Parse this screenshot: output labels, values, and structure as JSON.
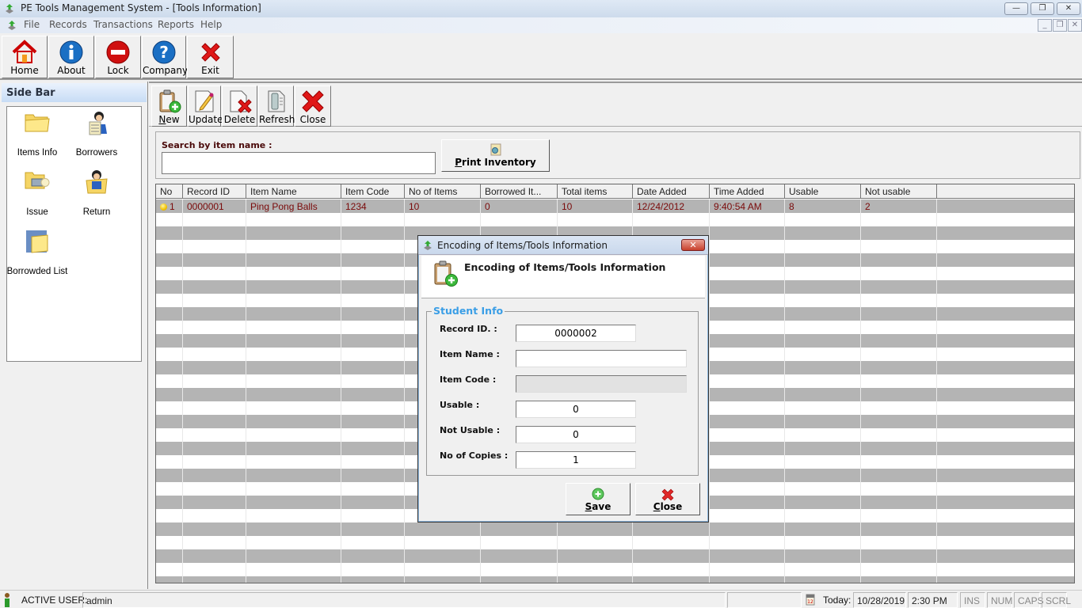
{
  "window": {
    "title": "PE Tools Management System - [Tools Information]",
    "controls": {
      "minimize": "—",
      "restore": "❐",
      "close": "✕"
    }
  },
  "menu": {
    "items": [
      "File",
      "Records",
      "Transactions",
      "Reports",
      "Help"
    ],
    "mdi_controls": {
      "minimize": "_",
      "restore": "❐",
      "close": "✕"
    }
  },
  "main_toolbar": {
    "buttons": [
      {
        "label": "Home",
        "icon": "home-icon"
      },
      {
        "label": "About",
        "icon": "info-icon"
      },
      {
        "label": "Lock",
        "icon": "lock-icon"
      },
      {
        "label": "Company",
        "icon": "help-icon"
      },
      {
        "label": "Exit",
        "icon": "exit-icon"
      }
    ]
  },
  "sidebar": {
    "title": "Side Bar",
    "items": [
      {
        "label": "Items Info",
        "icon": "folder-icon"
      },
      {
        "label": "Borrowers",
        "icon": "borrowers-icon"
      },
      {
        "label": "Issue",
        "icon": "issue-icon"
      },
      {
        "label": "Return",
        "icon": "return-icon"
      },
      {
        "label": "Borrowded List",
        "icon": "borrowed-list-icon"
      }
    ]
  },
  "sub_toolbar": {
    "buttons": [
      {
        "label": "New",
        "underline": "N",
        "rest": "ew",
        "icon": "new-icon"
      },
      {
        "label": "Update",
        "icon": "update-icon"
      },
      {
        "label": "Delete",
        "icon": "delete-icon"
      },
      {
        "label": "Refresh",
        "icon": "refresh-icon"
      },
      {
        "label": "Close",
        "icon": "close-icon"
      }
    ]
  },
  "search": {
    "label": "Search by item name :",
    "value": "",
    "print_button": {
      "underline": "P",
      "rest": "rint Inventory"
    }
  },
  "table": {
    "columns": [
      "No",
      "Record ID",
      "Item Name",
      "Item Code",
      "No of Items",
      "Borrowed It...",
      "Total items",
      "Date Added",
      "Time Added",
      "Usable",
      "Not usable"
    ],
    "rows": [
      [
        "1",
        "0000001",
        "Ping Pong Balls",
        "1234",
        "10",
        "0",
        "10",
        "12/24/2012",
        "9:40:54 AM",
        "8",
        "2"
      ]
    ]
  },
  "dialog": {
    "title": "Encoding of Items/Tools Information",
    "header": "Encoding of Items/Tools Information",
    "group_label": "Student Info",
    "fields": [
      {
        "label": "Record ID. :",
        "value": "0000002"
      },
      {
        "label": "Item Name :",
        "value": ""
      },
      {
        "label": "Item Code :",
        "value": ""
      },
      {
        "label": "Usable :",
        "value": "0"
      },
      {
        "label": "Not Usable :",
        "value": "0"
      },
      {
        "label": "No of Copies :",
        "value": "1"
      }
    ],
    "save_button": {
      "underline": "S",
      "rest": "ave"
    },
    "close_button": {
      "underline": "C",
      "rest": "lose"
    },
    "close_x": "✕"
  },
  "statusbar": {
    "active_user_label": "ACTIVE USER:",
    "active_user": "admin",
    "today_label": "Today:",
    "date": "10/28/2019",
    "time": "2:30 PM",
    "keys": [
      "INS",
      "NUM",
      "CAPS",
      "SCRL"
    ]
  },
  "colors": {
    "grid_row_alt": "#b4b4b4",
    "grid_text": "#7a0a0a",
    "group_label": "#3a9ee6"
  }
}
